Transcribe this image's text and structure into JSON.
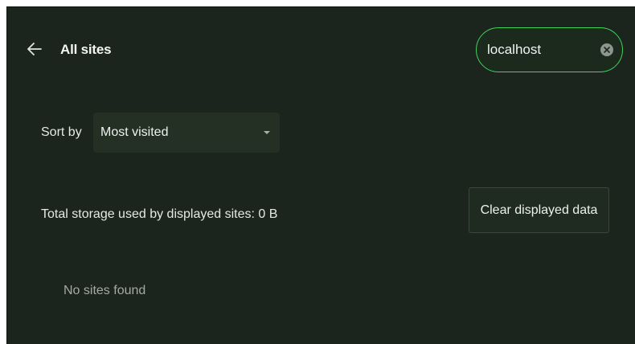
{
  "header": {
    "back_icon": "arrow-left-icon",
    "title": "All sites"
  },
  "search": {
    "value": "localhost",
    "clear_icon": "clear-circle-x-icon",
    "accent_color": "#3fd35c"
  },
  "sort": {
    "label": "Sort by",
    "selected": "Most visited",
    "dropdown_icon": "caret-down-icon"
  },
  "storage": {
    "summary": "Total storage used by displayed sites: 0 B",
    "clear_button_label": "Clear displayed data"
  },
  "results": {
    "empty_message": "No sites found"
  }
}
